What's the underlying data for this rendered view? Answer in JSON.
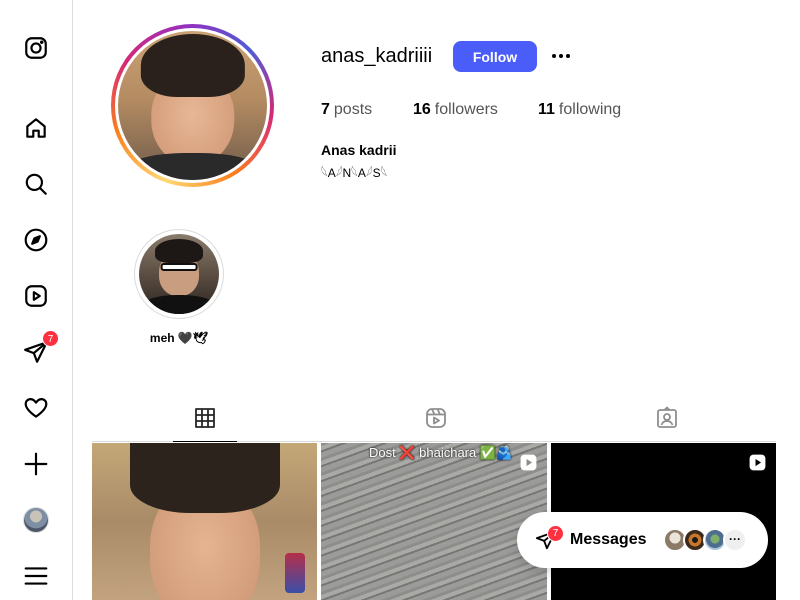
{
  "sidebar": {
    "items": [
      {
        "name": "instagram-logo-icon"
      },
      {
        "name": "home-icon"
      },
      {
        "name": "search-icon"
      },
      {
        "name": "explore-icon"
      },
      {
        "name": "reels-icon"
      },
      {
        "name": "messages-icon",
        "badge": "7"
      },
      {
        "name": "notifications-heart-icon"
      },
      {
        "name": "create-plus-icon"
      },
      {
        "name": "profile-avatar"
      },
      {
        "name": "menu-hamburger-icon"
      }
    ]
  },
  "profile": {
    "username": "anas_kadriiii",
    "follow_label": "Follow",
    "stats": {
      "posts_count": "7",
      "posts_label": "posts",
      "followers_count": "16",
      "followers_label": "followers",
      "following_count": "11",
      "following_label": "following"
    },
    "bio_name": "Anas kadrii",
    "bio_text": "𓆩A𓆪N𓆩A𓆪S𓆩"
  },
  "highlights": [
    {
      "label": "meh 🖤🕊"
    }
  ],
  "tabs": [
    {
      "name": "posts-grid",
      "active": true
    },
    {
      "name": "reels",
      "active": false
    },
    {
      "name": "tagged",
      "active": false
    }
  ],
  "posts": [
    {
      "caption": "",
      "is_reel": false
    },
    {
      "caption": "Dost ❌ bhaichara ✅🫂",
      "is_reel": true
    },
    {
      "caption": "",
      "is_reel": true
    }
  ],
  "messages": {
    "label": "Messages",
    "badge": "7",
    "more_glyph": "···"
  },
  "colors": {
    "accent": "#4a5df9",
    "badge": "#ff3040",
    "border": "#dbdbdb"
  }
}
